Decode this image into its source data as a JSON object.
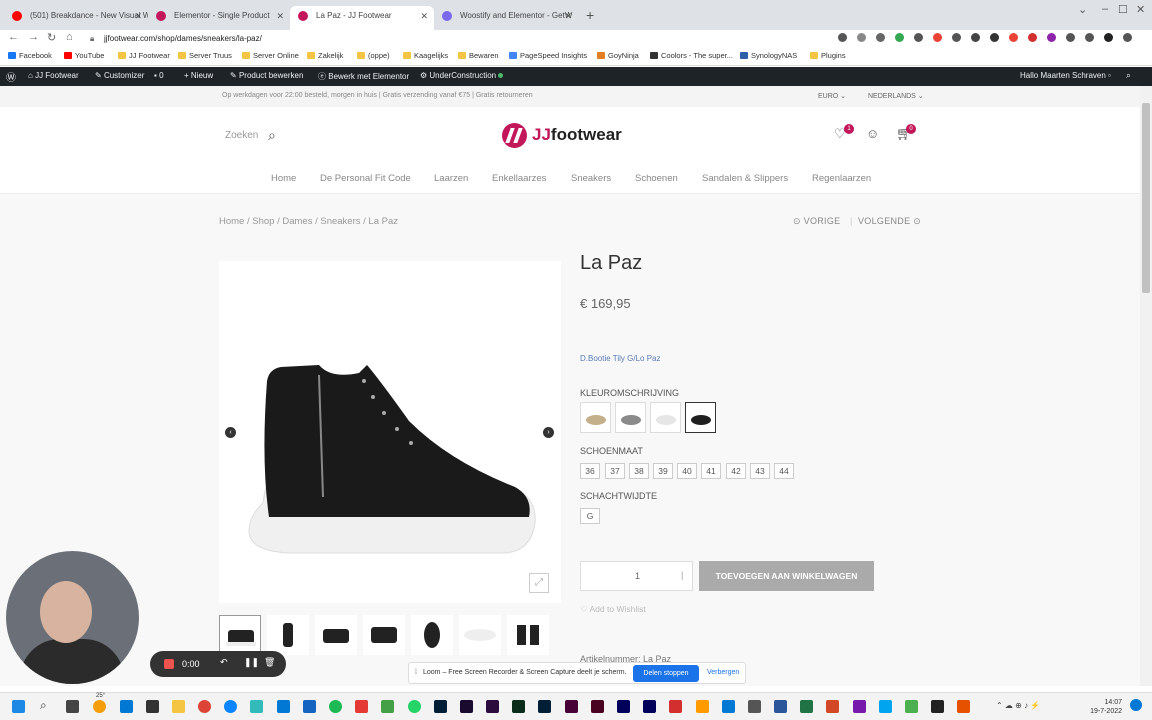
{
  "browser": {
    "tabs": [
      {
        "title": "(501) Breakdance - New Visual W",
        "color": "#ff0000",
        "active": false
      },
      {
        "title": "Elementor - Single Product",
        "color": "#c2185b",
        "active": false
      },
      {
        "title": "La Paz - JJ Footwear",
        "color": "#c2185b",
        "active": true
      },
      {
        "title": "Woostify and Elementor - GetW",
        "color": "#7b68ee",
        "active": false
      }
    ],
    "url": "jjfootwear.com/shop/dames/sneakers/la-paz/",
    "bookmarks": [
      "Facebook",
      "YouTube",
      "JJ Footwear",
      "Server Truus",
      "Server Online",
      "Zakelijk",
      "(oppe)",
      "Kaagelijks",
      "Bewaren",
      "PageSpeed Insights",
      "GoyNinja",
      "Coolors - The super...",
      "SynologyNAS",
      "Plugins"
    ]
  },
  "wpbar": {
    "site": "JJ Footwear",
    "customizer": "Customizer",
    "comments": "0",
    "new": "Nieuw",
    "edit_product": "Product bewerken",
    "edit_elementor": "Bewerk met Elementor",
    "under_construction": "UnderConstruction",
    "greeting": "Hallo Maarten Schraven"
  },
  "topstrip": {
    "message": "Op werkdagen voor 22:00 besteld, morgen in huis | Gratis verzending vanaf €75 | Gratis retourneren",
    "currency": "EURO",
    "country": "NEDERLANDS"
  },
  "header": {
    "search_label": "Zoeken",
    "logo_prefix": "JJ",
    "logo_text": "footwear",
    "wishlist_count": "1",
    "cart_count": "0",
    "menu": [
      "Home",
      "De Personal Fit Code",
      "Laarzen",
      "Enkellaarzes",
      "Sneakers",
      "Schoenen",
      "Sandalen & Slippers",
      "Regenlaarzen"
    ]
  },
  "breadcrumb": "Home / Shop / Dames / Sneakers / La Paz",
  "prev": "VORIGE",
  "next": "VOLGENDE",
  "product": {
    "title": "La Paz",
    "price": "€ 169,95",
    "brand_line": "D.Bootie Tily G/Lo Paz",
    "color_label": "KLEUROMSCHRIJVING",
    "swatches": [
      "#c4b08a",
      "#8a8a8a",
      "#e6e6e6",
      "#1f1f1f"
    ],
    "size_label": "SCHOENMAAT",
    "sizes": [
      "36",
      "37",
      "38",
      "39",
      "40",
      "41",
      "42",
      "43",
      "44"
    ],
    "width_label": "SCHACHTWIJDTE",
    "widths": [
      "G"
    ],
    "quantity": "1",
    "add_to_cart": "TOEVOEGEN AAN WINKELWAGEN",
    "wishlist": "Add to Wishlist",
    "article_number": "Artikelnummer: La Paz"
  },
  "recorder": {
    "time": "0:00"
  },
  "loom": {
    "message": "Loom – Free Screen Recorder & Screen Capture deelt je scherm.",
    "stop": "Delen stoppen",
    "hide": "Verbergen"
  },
  "taskbar": {
    "time": "14:07",
    "date": "19-7-2022",
    "weather": "25°"
  }
}
